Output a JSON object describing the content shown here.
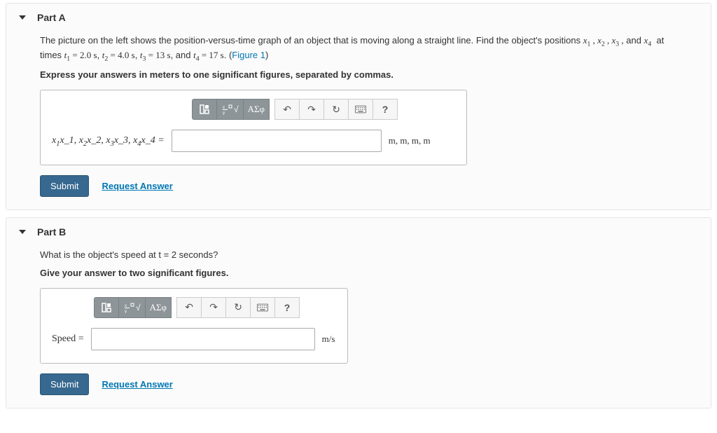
{
  "partA": {
    "title": "Part A",
    "prompt_pre": "The picture on the left shows the position-versus-time graph of an object that is moving along a straight line. Find the object's positions ",
    "prompt_vars": "x₁ , x₂ , x₃ , and x₄",
    "prompt_mid": " at times ",
    "times_text": "t₁ = 2.0 s, t₂ = 4.0 s, t₃ = 13 s, and t₄ = 17 s.",
    "figure_label": "(Figure 1)",
    "instructions": "Express your answers in meters to one significant figures, separated by commas.",
    "var_label": "x₁x_1, x₂x_2, x₃x_3, x₄x_4 =",
    "units": "m, m, m, m",
    "submit": "Submit",
    "request": "Request Answer"
  },
  "partB": {
    "title": "Part B",
    "prompt": "What is the object's speed at t = 2 seconds?",
    "instructions": "Give your answer to two significant figures.",
    "var_label": "Speed =",
    "units": "m/s",
    "submit": "Submit",
    "request": "Request Answer"
  },
  "toolbar": {
    "templates": "templates-icon",
    "fraction": "fraction-icon",
    "greek": "ΑΣφ",
    "undo": "↶",
    "redo": "↷",
    "reset": "↻",
    "keyboard": "⌨",
    "help": "?"
  }
}
